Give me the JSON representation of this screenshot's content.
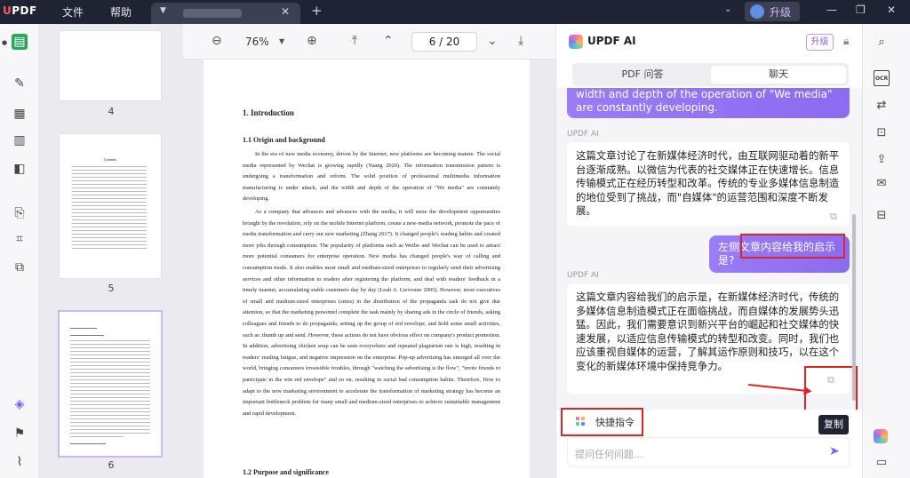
{
  "app": {
    "logo": "UPDF",
    "menu": [
      "文件",
      "帮助"
    ],
    "upgrade_label": "升级"
  },
  "thumbnails": {
    "pages": [
      {
        "label": "4"
      },
      {
        "label": "5",
        "heading": "Contents"
      },
      {
        "label": "6",
        "selected": true
      }
    ]
  },
  "toolbar": {
    "zoom": "76%",
    "page_current": "6",
    "page_total": "20",
    "page_separator": "/"
  },
  "document": {
    "h1": "1.  Introduction",
    "h2_origin": "1.1  Origin  and  background",
    "p1": "In the era of new media economy, driven by the Internet, new platforms are becoming mature. The social media represented by Wechat is growing rapidly (Yuang 2020). The information transmission pattern is undergoing a transformation and reform. The solid position of professional multimedia information manufacturing is under attack, and the width and depth of the operation of \"We media\" are constantly developing.",
    "p2": "As a company that advances and advances with the media, it will seize the development opportunities brought by the revolution, rely on the mobile Internet platform, create a new-media network, promote the pace of media transformation and carry out new marketing (Zhang 2017). It changed people's reading habits and created more jobs through consumption. The popularity of platforms such as Weibo and Wechat can be used to attract more potential consumers for enterprise operation. New media has changed people's way of calling and consumption mode. It also enables most small and medium-sized enterprises to regularly send their advertising services and other information to readers after registering the platform, and deal with readers' feedback in a timely manner, accumulating stable customers day by day (Leah A. Lievrouw 2005). However, most executives of small and medium-sized enterprises (smes) in the distribution of the propaganda task do not give due attention, so that the marketing personnel complete the task mainly by sharing ads in the circle of friends, asking colleagues and friends to do propaganda, setting up the group of red envelope, and hold some small activities, such as: thumb up and send. However, these actions do not have obvious effect on company's product promotion. In addition, advertising chicken soup can be seen everywhere and repeated plagiarism rate is high, resulting in readers' reading fatigue, and negative impression on the enterprise. Pop-up advertising has emerged all over the world, bringing consumers irresistible troubles, through \"watching the advertising is the flow\", \"invite friends to participate in the win red envelope\" and so on, resulting in social bad consumption habits. Therefore, How to adapt to the new marketing environment to accelerate the transformation of marketing strategy has become an important bottleneck problem for many small and medium-sized enterprises to achieve sustainable management and rapid development.",
    "h2_purpose": "1.2 Purpose and significance"
  },
  "ai_panel": {
    "title": "UPDF AI",
    "upgrade_label": "升级",
    "tabs": [
      "PDF 问答",
      "聊天"
    ],
    "active_tab": 1,
    "user_msg_top": "width and depth of the operation of \"We media\" are constantly developing.",
    "ai_label_1": "UPDF AI",
    "ai_reply_1": "这篇文章讨论了在新媒体经济时代，由互联网驱动着的新平台逐渐成熟。以微信为代表的社交媒体正在快速增长。信息传输模式正在经历转型和改革。传统的专业多媒体信息制造的地位受到了挑战，而\"自媒体\"的运营范围和深度不断发展。",
    "user_msg_2": "左侧文章内容给我的启示是?",
    "ai_label_2": "UPDF AI",
    "ai_reply_2": "这篇文章内容给我们的启示是，在新媒体经济时代，传统的多媒体信息制造模式正在面临挑战，而自媒体的发展势头迅猛。因此，我们需要意识到新兴平台的崛起和社交媒体的快速发展，以适应信息传输模式的转型和改变。同时，我们也应该重视自媒体的运营，了解其运作原则和技巧，以在这个变化的新媒体环境中保持竞争力。",
    "copy_tooltip": "复制",
    "quick_commands": "快捷指令",
    "input_placeholder": "提问任何问题..."
  },
  "colors": {
    "accent": "#8a5cf6",
    "titlebar": "#1f2333",
    "highlight_red": "#e02424",
    "rail_active": "#27a85a"
  }
}
